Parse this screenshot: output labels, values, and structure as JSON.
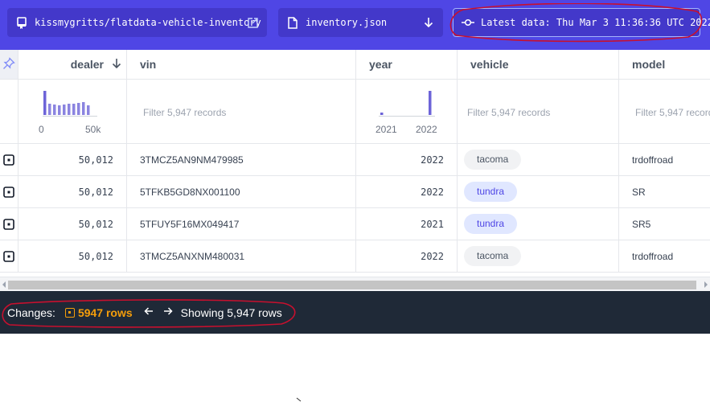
{
  "toolbar": {
    "repo": "kissmygritts/flatdata-vehicle-inventory",
    "file": "inventory.json",
    "commit": "Latest data: Thu Mar 3 11:36:36 UTC 2022"
  },
  "columns": {
    "dealer": "dealer",
    "vin": "vin",
    "year": "year",
    "vehicle": "vehicle",
    "model": "model"
  },
  "filters": {
    "placeholder": "Filter 5,947 records",
    "dealer_ticks": [
      "0",
      "50k"
    ],
    "year_ticks": [
      "2021",
      "2022"
    ]
  },
  "rows": [
    {
      "dealer": "50,012",
      "vin": "3TMCZ5AN9NM479985",
      "year": "2022",
      "vehicle": "tacoma",
      "model": "trdoffroad"
    },
    {
      "dealer": "50,012",
      "vin": "5TFKB5GD8NX001100",
      "year": "2022",
      "vehicle": "tundra",
      "model": "SR"
    },
    {
      "dealer": "50,012",
      "vin": "5TFUY5F16MX049417",
      "year": "2021",
      "vehicle": "tundra",
      "model": "SR5"
    },
    {
      "dealer": "50,012",
      "vin": "3TMCZ5ANXNM480031",
      "year": "2022",
      "vehicle": "tacoma",
      "model": "trdoffroad"
    }
  ],
  "footer": {
    "changes_label": "Changes:",
    "rows_badge": "5947 rows",
    "showing": "Showing 5,947 rows"
  },
  "colors": {
    "accent": "#4f46e5",
    "annotation": "#c8102e",
    "badge": "#f59e0b"
  },
  "icons": [
    "repo-icon",
    "external-link-icon",
    "file-icon",
    "download-arrow-icon",
    "commit-icon",
    "pin-icon",
    "sort-down-icon",
    "row-select-icon",
    "arrow-left-icon",
    "arrow-right-icon"
  ]
}
